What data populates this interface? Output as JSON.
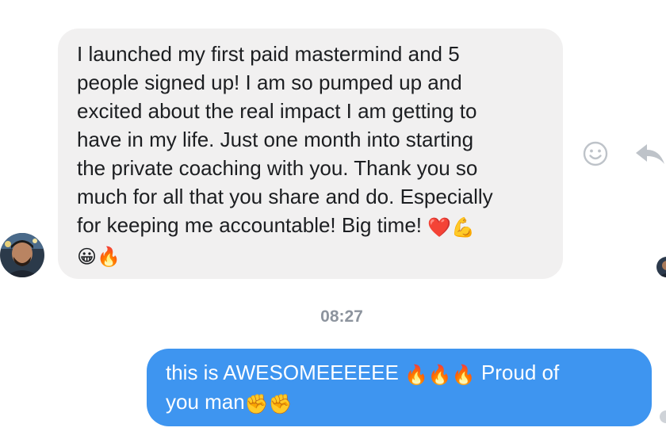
{
  "conversation": {
    "incoming": {
      "lines": [
        "I launched my first paid mastermind and 5",
        "people signed up! I am so pumped up and",
        "excited about the real impact I am getting to",
        "have in my life. Just one month into starting",
        "the private coaching with you. Thank you so",
        "much for all that you share and do. Especially",
        "for keeping me accountable! Big time!"
      ],
      "line7_emojis": [
        "❤️",
        "💪"
      ],
      "line8_emojis": [
        "😀",
        "🔥"
      ]
    },
    "timestamp": "08:27",
    "outgoing": {
      "line1_text": "this is AWESOMEEEEEE ",
      "line1_emojis": [
        "🔥",
        "🔥",
        "🔥"
      ],
      "line1_tail": " Proud of",
      "line2_text": "you man",
      "line2_emojis": [
        "✊",
        "✊"
      ]
    }
  },
  "actions": {
    "react_icon": "smiley-react-icon",
    "share_icon": "share-arrow-icon"
  },
  "colors": {
    "incoming_bubble": "#f1f0f0",
    "outgoing_bubble": "#3e95f0",
    "timestamp": "#8d949e",
    "icon": "#bec3c9"
  }
}
